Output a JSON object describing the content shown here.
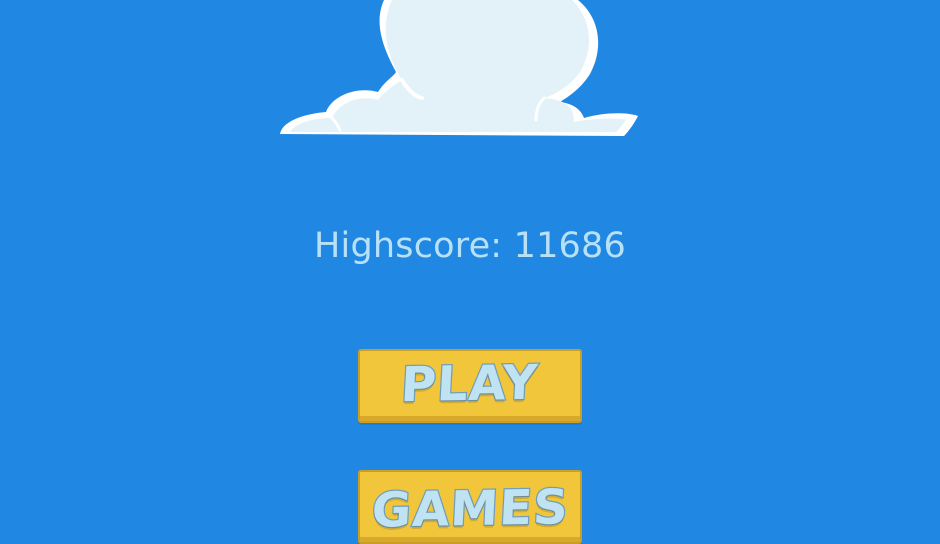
{
  "highscore": {
    "label": "Highscore:",
    "value": "11686"
  },
  "menu": {
    "play_label": "PLAY",
    "games_label": "GAMES"
  },
  "colors": {
    "background": "#2088e2",
    "cloud_fill": "#e3f1f9",
    "cloud_outline": "#ffffff",
    "button_fill": "#f1c63b",
    "button_text": "#bfe3f3",
    "highscore_text": "#b8e1f8"
  },
  "icons": {
    "cloud": "cloud-icon"
  }
}
